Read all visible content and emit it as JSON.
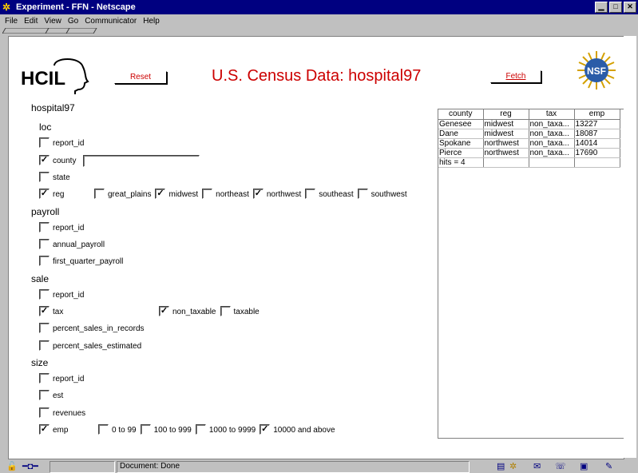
{
  "window": {
    "title": "Experiment - FFN - Netscape",
    "minimize": "▁",
    "maximize": "□",
    "close": "✕"
  },
  "menu": [
    "File",
    "Edit",
    "View",
    "Go",
    "Communicator",
    "Help"
  ],
  "header": {
    "reset_label": "Reset",
    "title": "U.S. Census Data: hospital97",
    "fetch_label": "Fetch",
    "hcil_logo_text": "HCIL",
    "nsf_logo_text": "NSF"
  },
  "schema": {
    "table_name": "hospital97",
    "loc": {
      "label": "loc",
      "report_id": {
        "label": "report_id",
        "checked": false
      },
      "county": {
        "label": "county",
        "checked": true,
        "value": ""
      },
      "state": {
        "label": "state",
        "checked": false
      },
      "reg": {
        "label": "reg",
        "checked": true,
        "options": [
          {
            "label": "great_plains",
            "checked": false
          },
          {
            "label": "midwest",
            "checked": true
          },
          {
            "label": "northeast",
            "checked": false
          },
          {
            "label": "northwest",
            "checked": true
          },
          {
            "label": "southeast",
            "checked": false
          },
          {
            "label": "southwest",
            "checked": false
          }
        ]
      }
    },
    "payroll": {
      "label": "payroll",
      "report_id": {
        "label": "report_id",
        "checked": false
      },
      "annual_payroll": {
        "label": "annual_payroll",
        "checked": false
      },
      "first_quarter_payroll": {
        "label": "first_quarter_payroll",
        "checked": false
      }
    },
    "sale": {
      "label": "sale",
      "report_id": {
        "label": "report_id",
        "checked": false
      },
      "tax": {
        "label": "tax",
        "checked": true,
        "options": [
          {
            "label": "non_taxable",
            "checked": true
          },
          {
            "label": "taxable",
            "checked": false
          }
        ]
      },
      "percent_sales_in_records": {
        "label": "percent_sales_in_records",
        "checked": false
      },
      "percent_sales_estimated": {
        "label": "percent_sales_estimated",
        "checked": false
      }
    },
    "size": {
      "label": "size",
      "report_id": {
        "label": "report_id",
        "checked": false
      },
      "est": {
        "label": "est",
        "checked": false
      },
      "revenues": {
        "label": "revenues",
        "checked": false
      },
      "emp": {
        "label": "emp",
        "checked": true,
        "options": [
          {
            "label": "0 to 99",
            "checked": false
          },
          {
            "label": "100 to 999",
            "checked": false
          },
          {
            "label": "1000 to 9999",
            "checked": false
          },
          {
            "label": "10000 and above",
            "checked": true
          }
        ]
      }
    }
  },
  "results": {
    "columns": [
      "county",
      "reg",
      "tax",
      "emp"
    ],
    "rows": [
      [
        "Genesee",
        "midwest",
        "non_taxa...",
        "13227"
      ],
      [
        "Dane",
        "midwest",
        "non_taxa...",
        "18087"
      ],
      [
        "Spokane",
        "northwest",
        "non_taxa...",
        "14014"
      ],
      [
        "Pierce",
        "northwest",
        "non_taxa...",
        "17690"
      ],
      [
        "hits = 4",
        "",
        "",
        ""
      ]
    ]
  },
  "status": {
    "text": "Document: Done"
  }
}
